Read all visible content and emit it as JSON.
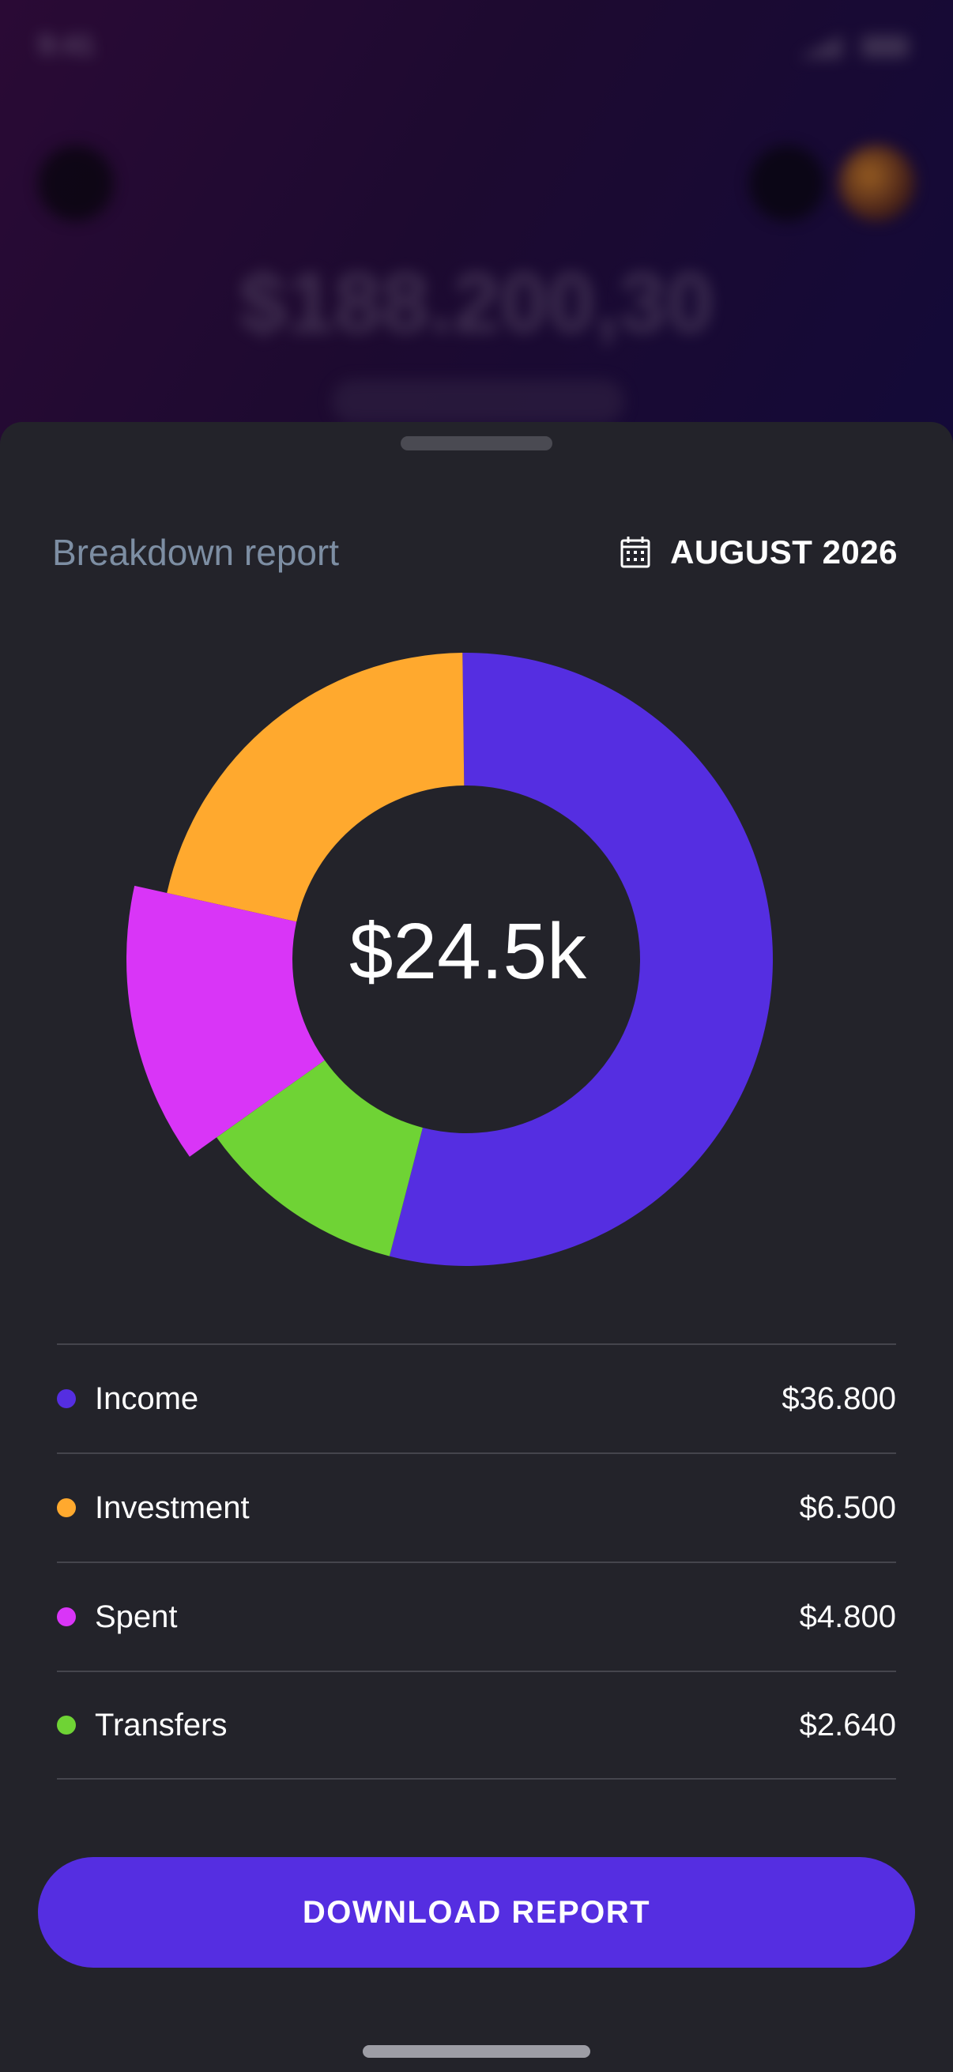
{
  "background": {
    "status_time": "9:41",
    "balance": "$188.200,30",
    "pill_text": "Account **** 4680"
  },
  "sheet": {
    "title": "Breakdown report",
    "date_icon": "calendar-icon",
    "date_label": "AUGUST 2026",
    "center_value": "$24.5k",
    "download_label": "DOWNLOAD REPORT"
  },
  "legend": [
    {
      "label": "Income",
      "value": "$36.800",
      "color": "#552ee1"
    },
    {
      "label": "Investment",
      "value": "$6.500",
      "color": "#ffa92e"
    },
    {
      "label": "Spent",
      "value": "$4.800",
      "color": "#d935f7"
    },
    {
      "label": "Transfers",
      "value": "$2.640",
      "color": "#6fd335"
    }
  ],
  "chart_data": {
    "type": "pie",
    "style": "donut",
    "categories": [
      "Income",
      "Investment",
      "Spent",
      "Transfers"
    ],
    "values": [
      36800,
      6500,
      4800,
      2640
    ],
    "colors": [
      "#552ee1",
      "#ffa92e",
      "#d935f7",
      "#6fd335"
    ],
    "angles": [
      {
        "start": -0.7,
        "end": 194.5
      },
      {
        "start": 282.5,
        "end": 359.3
      },
      {
        "start": 234.5,
        "end": 282.5
      },
      {
        "start": 194.5,
        "end": 234.5
      }
    ],
    "center_label": "$24.5k",
    "highlighted": "Spent"
  }
}
